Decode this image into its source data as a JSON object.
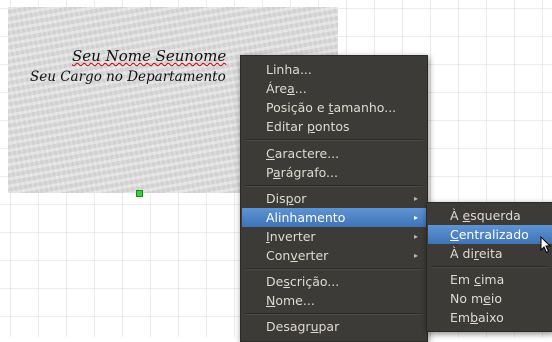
{
  "card": {
    "name": "Seu Nome Seunome",
    "title": "Seu Cargo no Departamento"
  },
  "context_menu": {
    "items": [
      {
        "pre": "Linha...",
        "acc": "",
        "post": ""
      },
      {
        "pre": "Áre",
        "acc": "a",
        "post": "..."
      },
      {
        "pre": "Posição e ",
        "acc": "t",
        "post": "amanho..."
      },
      {
        "pre": "Editar ",
        "acc": "p",
        "post": "ontos"
      },
      {
        "pre": "",
        "acc": "C",
        "post": "aractere..."
      },
      {
        "pre": "P",
        "acc": "a",
        "post": "rágrafo..."
      },
      {
        "pre": "Dis",
        "acc": "p",
        "post": "or"
      },
      {
        "pre": "Alinhamento",
        "acc": "",
        "post": ""
      },
      {
        "pre": "",
        "acc": "I",
        "post": "nverter"
      },
      {
        "pre": "Con",
        "acc": "v",
        "post": "erter"
      },
      {
        "pre": "De",
        "acc": "s",
        "post": "crição..."
      },
      {
        "pre": "",
        "acc": "N",
        "post": "ome..."
      },
      {
        "pre": "Desagr",
        "acc": "u",
        "post": "par"
      }
    ]
  },
  "submenu": {
    "items": [
      {
        "pre": "À ",
        "acc": "e",
        "post": "squerda"
      },
      {
        "pre": "",
        "acc": "C",
        "post": "entralizado"
      },
      {
        "pre": "À di",
        "acc": "r",
        "post": "eita"
      },
      {
        "pre": "Em ",
        "acc": "c",
        "post": "ima"
      },
      {
        "pre": "No m",
        "acc": "e",
        "post": "io"
      },
      {
        "pre": "Em",
        "acc": "b",
        "post": "aixo"
      }
    ]
  },
  "icons": {
    "submenu_arrow": "triangle-right-icon",
    "cursor": "arrow-pointer-icon"
  },
  "colors": {
    "menu_bg": "#3c3b37",
    "menu_text": "#dfdbd2",
    "highlight": "#4a80c4",
    "selection_handle": "#3bd13b"
  }
}
